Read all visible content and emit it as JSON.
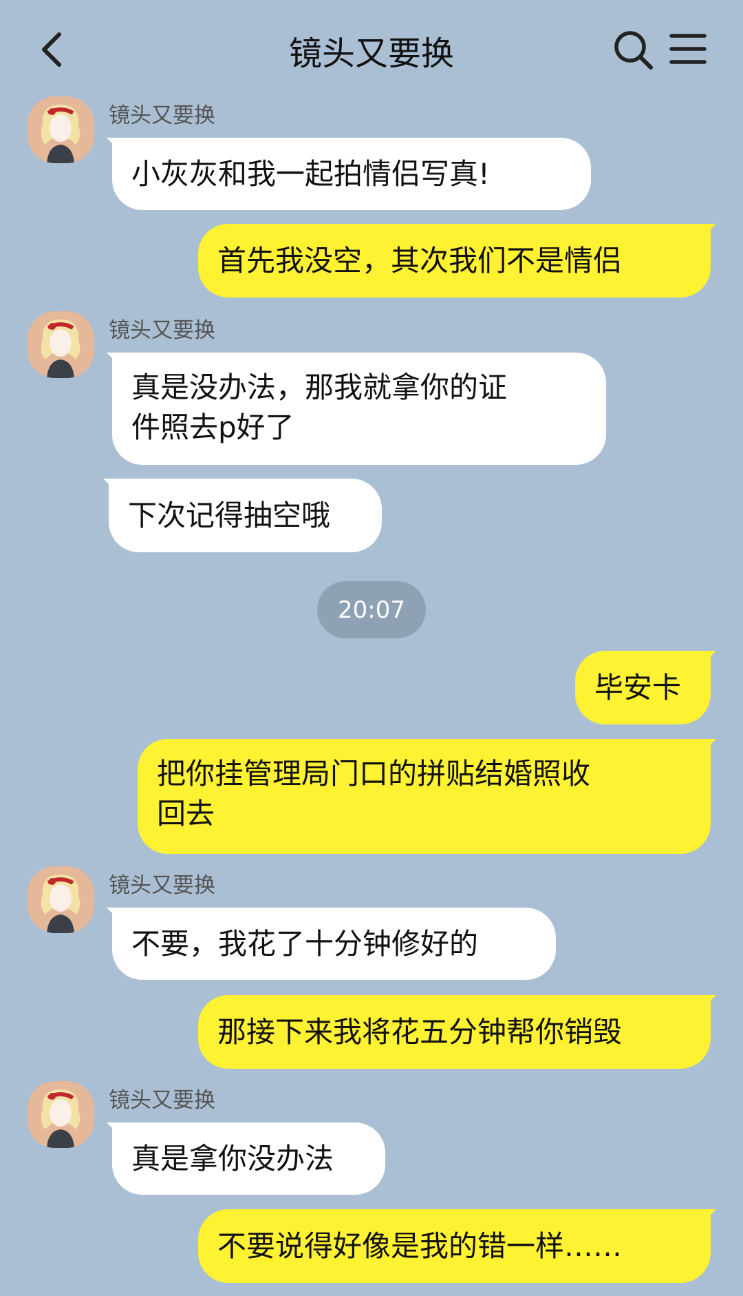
{
  "header": {
    "title": "镜头又要换",
    "back_icon": "chevron-left-icon",
    "search_icon": "search-icon",
    "menu_icon": "hamburger-menu-icon"
  },
  "colors": {
    "background": "#aabfd3",
    "incoming_bubble": "#ffffff",
    "outgoing_bubble": "#fef232",
    "timestamp_pill": "#8fa2b5"
  },
  "messages": [
    {
      "side": "in",
      "sender": "镜头又要换",
      "text": "小灰灰和我一起拍情侣写真!"
    },
    {
      "side": "out",
      "text": "首先我没空，其次我们不是情侣"
    },
    {
      "side": "in",
      "sender": "镜头又要换",
      "text": "真是没办法，那我就拿你的证\n件照去p好了"
    },
    {
      "side": "in",
      "text": "下次记得抽空哦"
    },
    {
      "type": "timestamp",
      "text": "20:07"
    },
    {
      "side": "out",
      "text": "毕安卡"
    },
    {
      "side": "out",
      "text": "把你挂管理局门口的拼贴结婚照收\n回去"
    },
    {
      "side": "in",
      "sender": "镜头又要换",
      "text": "不要，我花了十分钟修好的"
    },
    {
      "side": "out",
      "text": "那接下来我将花五分钟帮你销毁"
    },
    {
      "side": "in",
      "sender": "镜头又要换",
      "text": "真是拿你没办法"
    },
    {
      "side": "out",
      "text": "不要说得好像是我的错一样……"
    }
  ]
}
